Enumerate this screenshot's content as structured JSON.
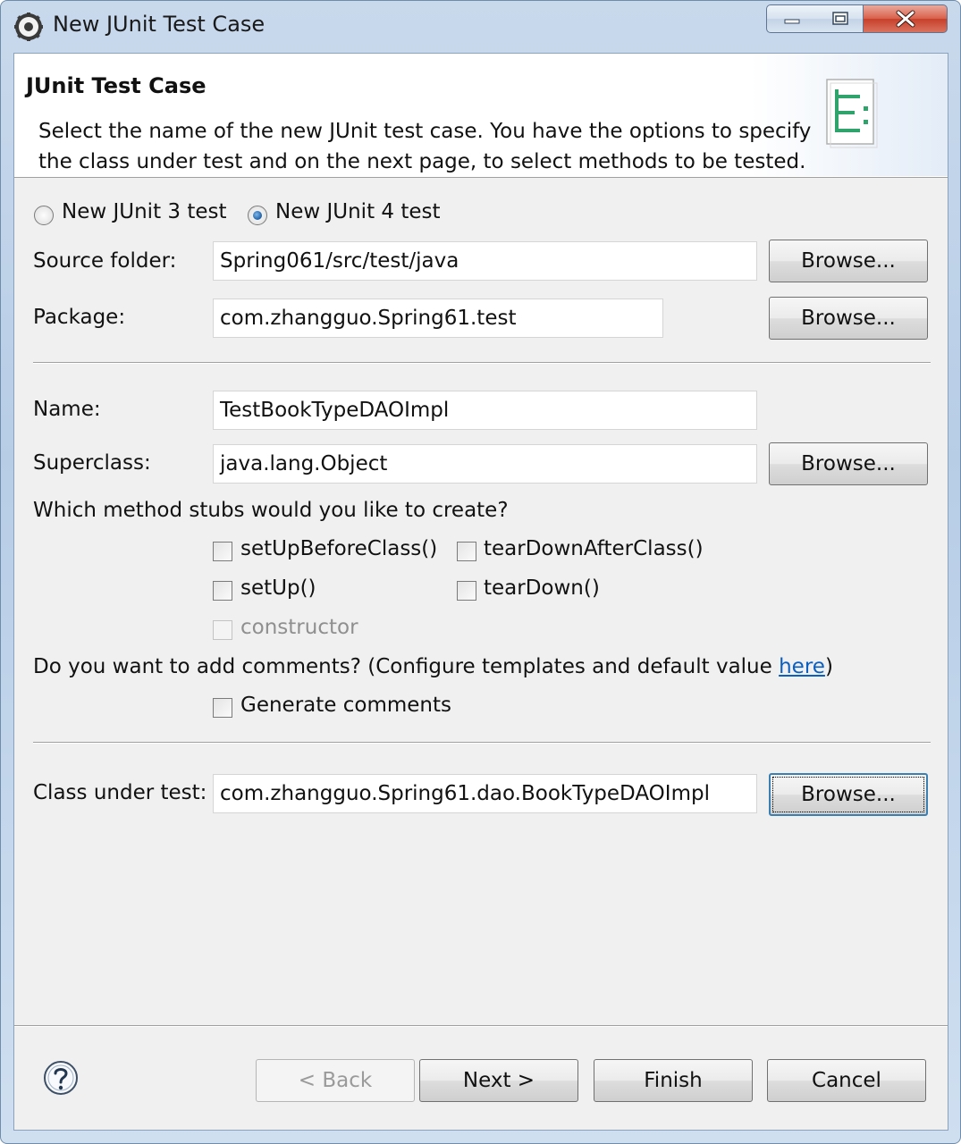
{
  "window": {
    "title": "New JUnit Test Case",
    "controls": [
      "minimize",
      "maximize",
      "close"
    ]
  },
  "banner": {
    "title": "JUnit Test Case",
    "description": "Select the name of the new JUnit test case. You have the options to specify the class under test and on the next page, to select methods to be tested.",
    "icon": "junit-wizard-icon"
  },
  "version": {
    "junit3_label": "New JUnit 3 test",
    "junit4_label": "New JUnit 4 test",
    "selected": "junit4"
  },
  "form": {
    "source_folder": {
      "label": "Source folder:",
      "value": "Spring061/src/test/java",
      "browse": "Browse..."
    },
    "package": {
      "label": "Package:",
      "value": "com.zhangguo.Spring61.test",
      "browse": "Browse..."
    },
    "name": {
      "label": "Name:",
      "value": "TestBookTypeDAOImpl"
    },
    "superclass": {
      "label": "Superclass:",
      "value": "java.lang.Object",
      "browse": "Browse..."
    }
  },
  "stubs": {
    "question": "Which method stubs would you like to create?",
    "setUpBeforeClass": {
      "label": "setUpBeforeClass()",
      "checked": false
    },
    "tearDownAfterClass": {
      "label": "tearDownAfterClass()",
      "checked": false
    },
    "setUp": {
      "label": "setUp()",
      "checked": false
    },
    "tearDown": {
      "label": "tearDown()",
      "checked": false
    },
    "constructor": {
      "label": "constructor",
      "checked": false,
      "enabled": false
    }
  },
  "comments": {
    "question_prefix": "Do you want to add comments? (Configure templates and default value ",
    "link": "here",
    "question_suffix": ")",
    "generate": {
      "label": "Generate comments",
      "checked": false
    }
  },
  "class_under_test": {
    "label": "Class under test:",
    "value": "com.zhangguo.Spring61.dao.BookTypeDAOImpl",
    "browse": "Browse..."
  },
  "footer": {
    "help_icon": "help-icon",
    "back": "< Back",
    "next": "Next >",
    "finish": "Finish",
    "cancel": "Cancel"
  }
}
